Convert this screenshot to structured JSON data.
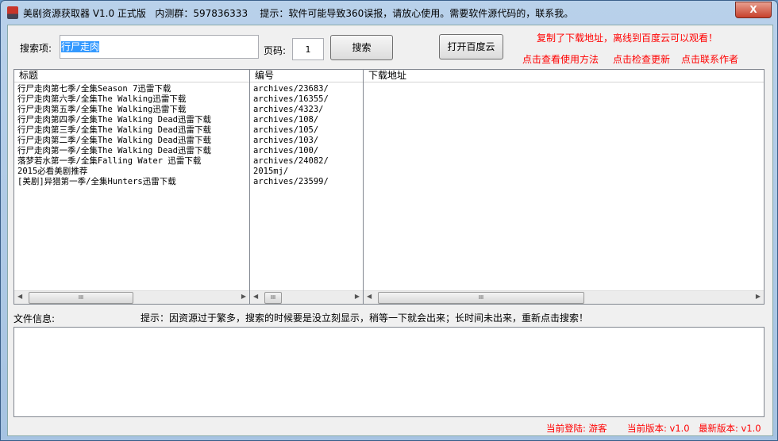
{
  "title": "美剧资源获取器 V1.0 正式版   内测群：597836333    提示：软件可能导致360误报，请放心使用。需要软件源代码的，联系我。",
  "close": "X",
  "search": {
    "label": "搜索项:",
    "value": "行尸走肉",
    "page_label": "页码:",
    "page_value": "1",
    "button": "搜索"
  },
  "baidu_button": "打开百度云",
  "notice": "复制了下载地址，离线到百度云可以观看！",
  "links": [
    "点击查看使用方法",
    "点击检查更新",
    "点击联系作者"
  ],
  "columns": [
    "标题",
    "编号",
    "下载地址"
  ],
  "rows": [
    {
      "title": "行尸走肉第七季/全集Season 7迅雷下载",
      "id": "archives/23683/"
    },
    {
      "title": "行尸走肉第六季/全集The Walking迅雷下载",
      "id": "archives/16355/"
    },
    {
      "title": "行尸走肉第五季/全集The Walking迅雷下载",
      "id": "archives/4323/"
    },
    {
      "title": "行尸走肉第四季/全集The Walking Dead迅雷下载",
      "id": "archives/108/"
    },
    {
      "title": "行尸走肉第三季/全集The Walking Dead迅雷下载",
      "id": "archives/105/"
    },
    {
      "title": "行尸走肉第二季/全集The Walking Dead迅雷下载",
      "id": "archives/103/"
    },
    {
      "title": "行尸走肉第一季/全集The Walking Dead迅雷下载",
      "id": "archives/100/"
    },
    {
      "title": "落梦若水第一季/全集Falling Water 迅雷下载",
      "id": "archives/24082/"
    },
    {
      "title": "2015必看美剧推荐",
      "id": "2015mj/"
    },
    {
      "title": "[美剧]异猎第一季/全集Hunters迅雷下载",
      "id": "archives/23599/"
    }
  ],
  "file_info_label": "文件信息:",
  "tip": "提示：因资源过于繁多，搜索的时候要是没立刻显示，稍等一下就会出来；长时间未出来，重新点击搜索！",
  "status": {
    "login": "当前登陆: 游客",
    "current_version": "当前版本: v1.0",
    "latest_version": "最新版本: v1.0"
  }
}
